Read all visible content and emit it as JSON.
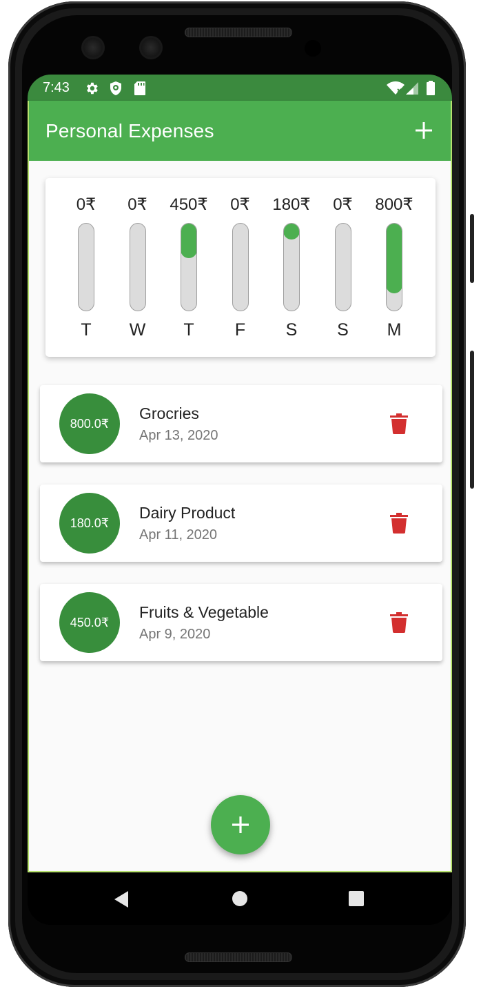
{
  "status_bar": {
    "time": "7:43",
    "icons": [
      "gear-icon",
      "shield-icon",
      "sd-card-icon",
      "wifi-icon",
      "signal-icon",
      "battery-icon"
    ]
  },
  "app_bar": {
    "title": "Personal Expenses",
    "add_icon": "plus-icon"
  },
  "colors": {
    "primary": "#4caf50",
    "primary_dark": "#388e3c",
    "status_bar": "#3b8a3e",
    "delete": "#d32f2f",
    "track": "#dcdcdc"
  },
  "chart": {
    "days": [
      {
        "day": "T",
        "amount": "0₹",
        "fraction": 0
      },
      {
        "day": "W",
        "amount": "0₹",
        "fraction": 0
      },
      {
        "day": "T",
        "amount": "450₹",
        "fraction": 0.4
      },
      {
        "day": "F",
        "amount": "0₹",
        "fraction": 0
      },
      {
        "day": "S",
        "amount": "180₹",
        "fraction": 0.16
      },
      {
        "day": "S",
        "amount": "0₹",
        "fraction": 0
      },
      {
        "day": "M",
        "amount": "800₹",
        "fraction": 0.8
      }
    ]
  },
  "transactions": [
    {
      "amount": "800.0₹",
      "title": "Grocries",
      "date": "Apr 13, 2020"
    },
    {
      "amount": "180.0₹",
      "title": "Dairy Product",
      "date": "Apr 11, 2020"
    },
    {
      "amount": "450.0₹",
      "title": "Fruits & Vegetable",
      "date": "Apr 9, 2020"
    }
  ],
  "fab": {
    "icon": "plus-icon"
  },
  "nav_bar": {
    "icons": [
      "back-icon",
      "home-icon",
      "recents-icon"
    ]
  }
}
